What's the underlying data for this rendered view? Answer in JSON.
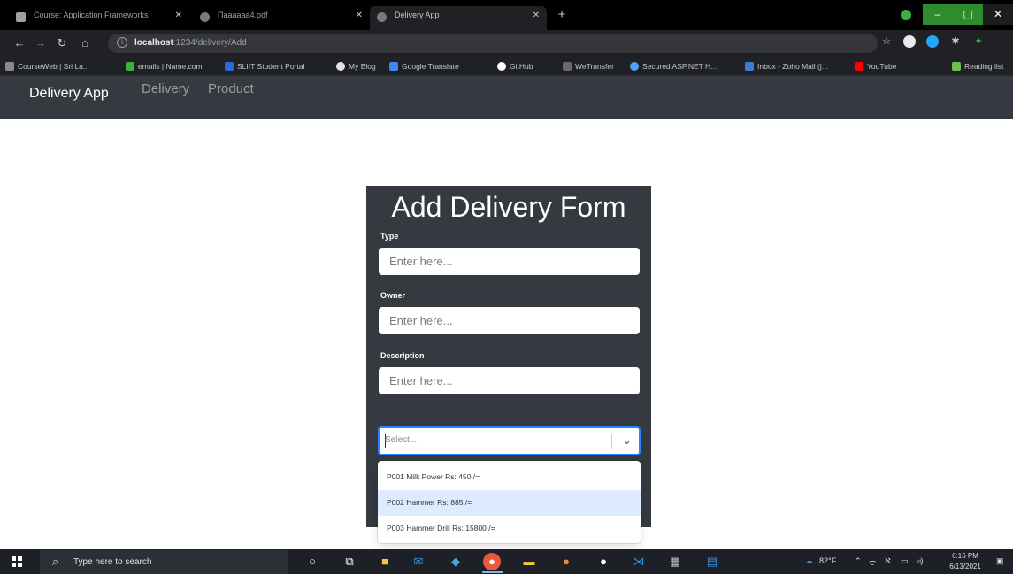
{
  "browser": {
    "tabs": [
      {
        "title": "Course: Application Frameworks",
        "active": false,
        "has_close": true
      },
      {
        "title": "Паааааа4.pdf",
        "active": false,
        "has_close": true
      },
      {
        "title": "Delivery App",
        "active": true,
        "has_close": true
      }
    ],
    "url_host": "localhost",
    "url_path": ":1234/delivery/Add",
    "bookmarks": [
      {
        "label": "CourseWeb | Sri La...",
        "color": "#8a8a8a"
      },
      {
        "label": "emails | Name.com",
        "color": "#3cb043"
      },
      {
        "label": "SLIIT Student Portal",
        "color": "#2a6ad8"
      },
      {
        "label": "My Blog",
        "color": "#e0e0e0"
      },
      {
        "label": "Google Translate",
        "color": "#4285f4"
      },
      {
        "label": "GitHub",
        "color": "#ffffff"
      },
      {
        "label": "WeTransfer",
        "color": "#6a6a6a"
      },
      {
        "label": "Secured ASP.NET H...",
        "color": "#4da3ff"
      },
      {
        "label": "Inbox - Zoho Mail (j...",
        "color": "#3a7bd5"
      },
      {
        "label": "YouTube",
        "color": "#ff0000"
      },
      {
        "label": "Reading list",
        "color": "#6cc04a"
      }
    ]
  },
  "app": {
    "brand": "Delivery App",
    "nav": [
      "Delivery",
      "Product"
    ]
  },
  "form": {
    "title": "Add Delivery Form",
    "type_label": "Type",
    "type_placeholder": "Enter here...",
    "owner_label": "Owner",
    "owner_placeholder": "Enter here...",
    "description_label": "Description",
    "description_placeholder": "Enter here...",
    "select_placeholder": "Select...",
    "options": [
      "P001 Milk Power Rs: 450 /=",
      "P002 Hammer Rs: 885 /=",
      "P003 Hammer Drill Rs: 15800 /="
    ],
    "focused_option": 1
  },
  "taskbar": {
    "search_placeholder": "Type here to search",
    "temperature": "82°F",
    "time": "6:16 PM",
    "date": "6/13/2021"
  }
}
